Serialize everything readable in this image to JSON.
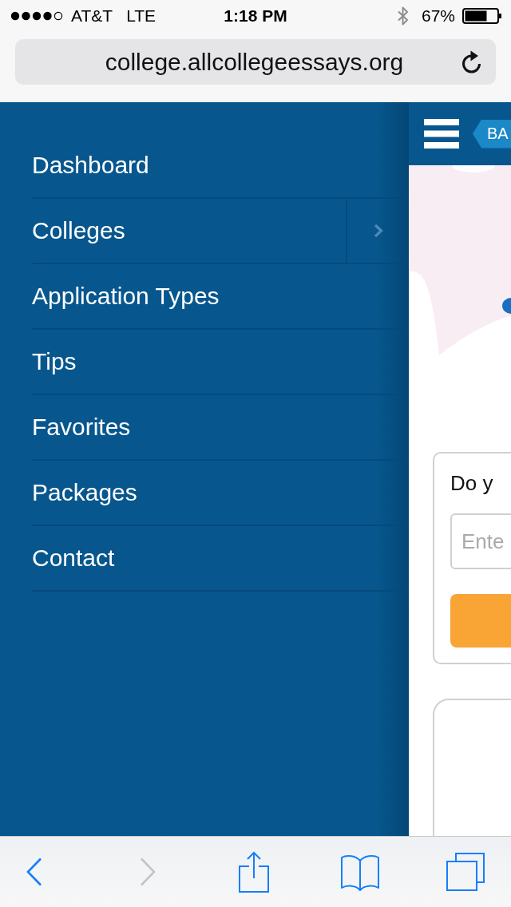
{
  "status_bar": {
    "carrier": "AT&T",
    "network": "LTE",
    "time": "1:18 PM",
    "battery": "67%"
  },
  "address_bar": {
    "url": "college.allcollegeessays.org"
  },
  "side_menu": {
    "items": [
      {
        "label": "Dashboard",
        "expandable": false
      },
      {
        "label": "Colleges",
        "expandable": true
      },
      {
        "label": "Application Types",
        "expandable": false
      },
      {
        "label": "Tips",
        "expandable": false
      },
      {
        "label": "Favorites",
        "expandable": false
      },
      {
        "label": "Packages",
        "expandable": false
      },
      {
        "label": "Contact",
        "expandable": false
      }
    ]
  },
  "page": {
    "back_button": "BA",
    "question_card": {
      "question": "Do y",
      "input": {
        "placeholder": "Ente"
      }
    }
  },
  "toolbar": {
    "items": [
      {
        "kind": "back",
        "disabled": false
      },
      {
        "kind": "forward",
        "disabled": true
      },
      {
        "kind": "share",
        "disabled": false
      },
      {
        "kind": "bookmarks",
        "disabled": false
      },
      {
        "kind": "tabs",
        "disabled": false
      }
    ]
  }
}
